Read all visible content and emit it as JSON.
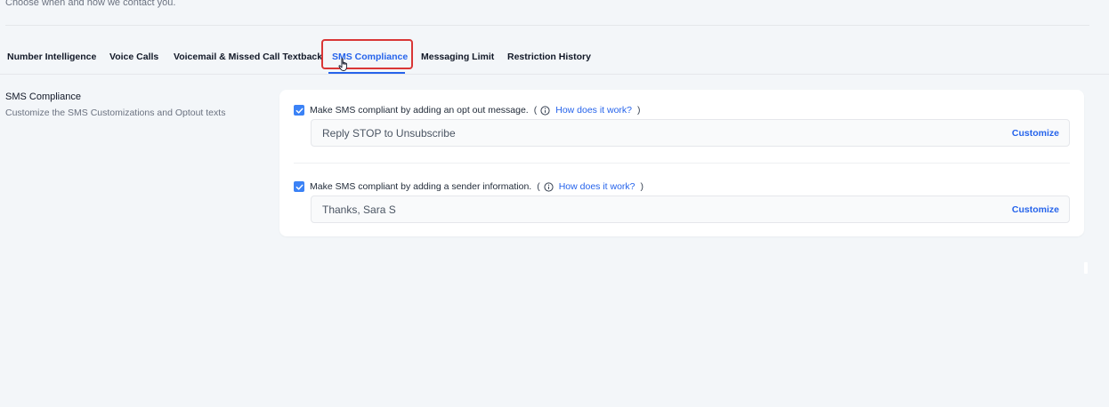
{
  "header": {
    "subtitle": "Choose when and how we contact you."
  },
  "tabs": [
    {
      "label": "Number Intelligence",
      "active": false
    },
    {
      "label": "Voice Calls",
      "active": false
    },
    {
      "label": "Voicemail & Missed Call Textback",
      "active": false
    },
    {
      "label": "SMS Compliance",
      "active": true
    },
    {
      "label": "Messaging Limit",
      "active": false
    },
    {
      "label": "Restriction History",
      "active": false
    }
  ],
  "section": {
    "title": "SMS Compliance",
    "description": "Customize the SMS Customizations and Optout texts"
  },
  "settings": {
    "opt_out": {
      "checked": true,
      "label": "Make SMS compliant by adding an opt out message.",
      "paren_open": "(",
      "help_link": "How does it work?",
      "paren_close": ")",
      "value": "Reply STOP to Unsubscribe",
      "customize_label": "Customize"
    },
    "sender_info": {
      "checked": true,
      "label": "Make SMS compliant by adding a sender information.",
      "paren_open": "(",
      "help_link": "How does it work?",
      "paren_close": ")",
      "value": "Thanks, Sara S",
      "customize_label": "Customize"
    }
  },
  "colors": {
    "accent": "#2563eb",
    "checkbox": "#3b82f6",
    "highlight_border": "#d93636",
    "background": "#f3f6f9"
  }
}
